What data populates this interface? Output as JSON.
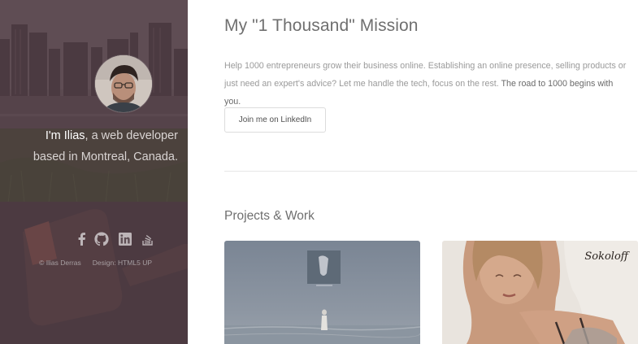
{
  "sidebar": {
    "intro_name": "I'm Ilias",
    "intro_rest_1": ", a web developer",
    "intro_rest_2": "based in Montreal, Canada.",
    "social_icons": [
      "facebook-icon",
      "github-icon",
      "linkedin-icon",
      "stackoverflow-icon"
    ],
    "footer_copyright": "© Ilias Derras",
    "footer_design": "Design: HTML5 UP"
  },
  "main": {
    "mission_title": "My \"1 Thousand\" Mission",
    "mission_text_1": "Help 1000 entrepreneurs grow their business online. Establishing an online presence, selling products or just need an expert's advice? Let me handle the tech, focus on the rest. ",
    "mission_text_2": "The road to 1000 begins with you.",
    "linkedin_button": "Join me on LinkedIn",
    "projects_title": "Projects & Work",
    "project_2_logo": "Sokoloff"
  },
  "colors": {
    "sidebar_bg": "#5f4f55",
    "accent_text": "#6f6f6f"
  }
}
